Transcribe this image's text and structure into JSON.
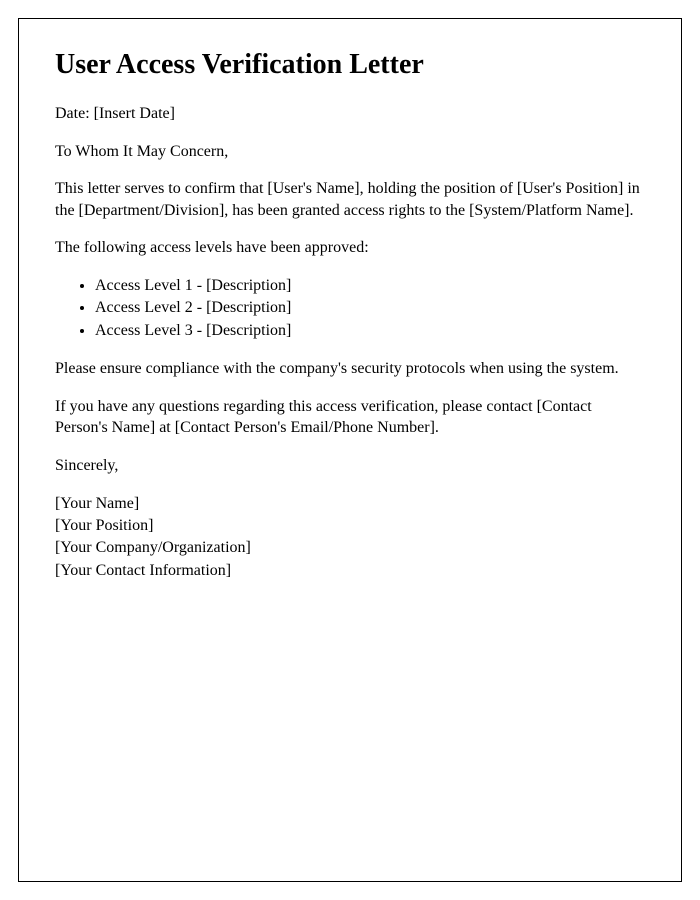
{
  "title": "User Access Verification Letter",
  "date_line": "Date: [Insert Date]",
  "salutation": "To Whom It May Concern,",
  "intro": "This letter serves to confirm that [User's Name], holding the position of [User's Position] in the [Department/Division], has been granted access rights to the [System/Platform Name].",
  "levels_intro": "The following access levels have been approved:",
  "access_levels": [
    "Access Level 1 - [Description]",
    "Access Level 2 - [Description]",
    "Access Level 3 - [Description]"
  ],
  "compliance": "Please ensure compliance with the company's security protocols when using the system.",
  "contact": "If you have any questions regarding this access verification, please contact [Contact Person's Name] at [Contact Person's Email/Phone Number].",
  "closing": "Sincerely,",
  "signature": {
    "name": "[Your Name]",
    "position": "[Your Position]",
    "company": "[Your Company/Organization]",
    "contact_info": "[Your Contact Information]"
  }
}
